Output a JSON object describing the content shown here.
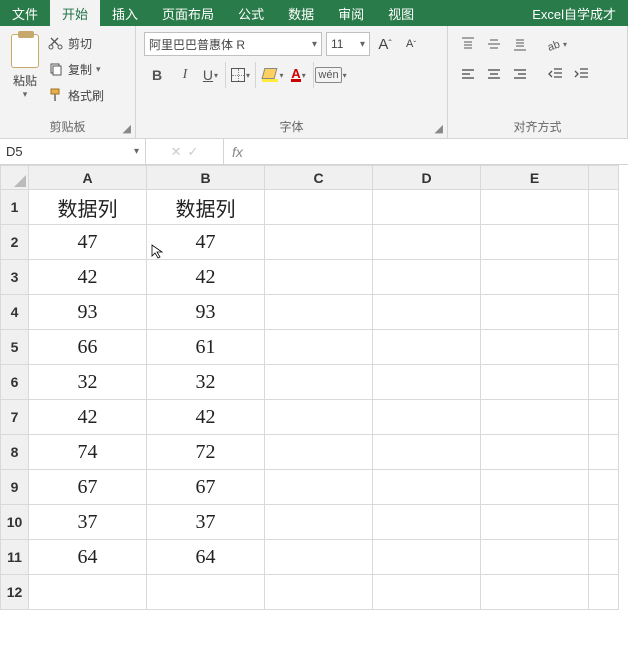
{
  "menu": {
    "tabs": [
      "文件",
      "开始",
      "插入",
      "页面布局",
      "公式",
      "数据",
      "审阅",
      "视图"
    ],
    "active_index": 1,
    "right": "Excel自学成才"
  },
  "ribbon": {
    "clipboard": {
      "paste": "粘贴",
      "cut": "剪切",
      "copy": "复制",
      "format_painter": "格式刷",
      "group_label": "剪贴板"
    },
    "font": {
      "name": "阿里巴巴普惠体 R",
      "size": "11",
      "group_label": "字体",
      "wen": "wén"
    },
    "align": {
      "group_label": "对齐方式"
    }
  },
  "namebar": {
    "cell_ref": "D5",
    "fx": "fx",
    "formula": ""
  },
  "sheet": {
    "cols": [
      "A",
      "B",
      "C",
      "D",
      "E",
      ""
    ],
    "rows": [
      {
        "n": 1,
        "cells": [
          "数据列",
          "数据列",
          "",
          "",
          "",
          ""
        ]
      },
      {
        "n": 2,
        "cells": [
          "47",
          "47",
          "",
          "",
          "",
          ""
        ]
      },
      {
        "n": 3,
        "cells": [
          "42",
          "42",
          "",
          "",
          "",
          ""
        ]
      },
      {
        "n": 4,
        "cells": [
          "93",
          "93",
          "",
          "",
          "",
          ""
        ]
      },
      {
        "n": 5,
        "cells": [
          "66",
          "61",
          "",
          "",
          "",
          ""
        ]
      },
      {
        "n": 6,
        "cells": [
          "32",
          "32",
          "",
          "",
          "",
          ""
        ]
      },
      {
        "n": 7,
        "cells": [
          "42",
          "42",
          "",
          "",
          "",
          ""
        ]
      },
      {
        "n": 8,
        "cells": [
          "74",
          "72",
          "",
          "",
          "",
          ""
        ]
      },
      {
        "n": 9,
        "cells": [
          "67",
          "67",
          "",
          "",
          "",
          ""
        ]
      },
      {
        "n": 10,
        "cells": [
          "37",
          "37",
          "",
          "",
          "",
          ""
        ]
      },
      {
        "n": 11,
        "cells": [
          "64",
          "64",
          "",
          "",
          "",
          ""
        ]
      },
      {
        "n": 12,
        "cells": [
          "",
          "",
          "",
          "",
          "",
          ""
        ]
      }
    ]
  }
}
